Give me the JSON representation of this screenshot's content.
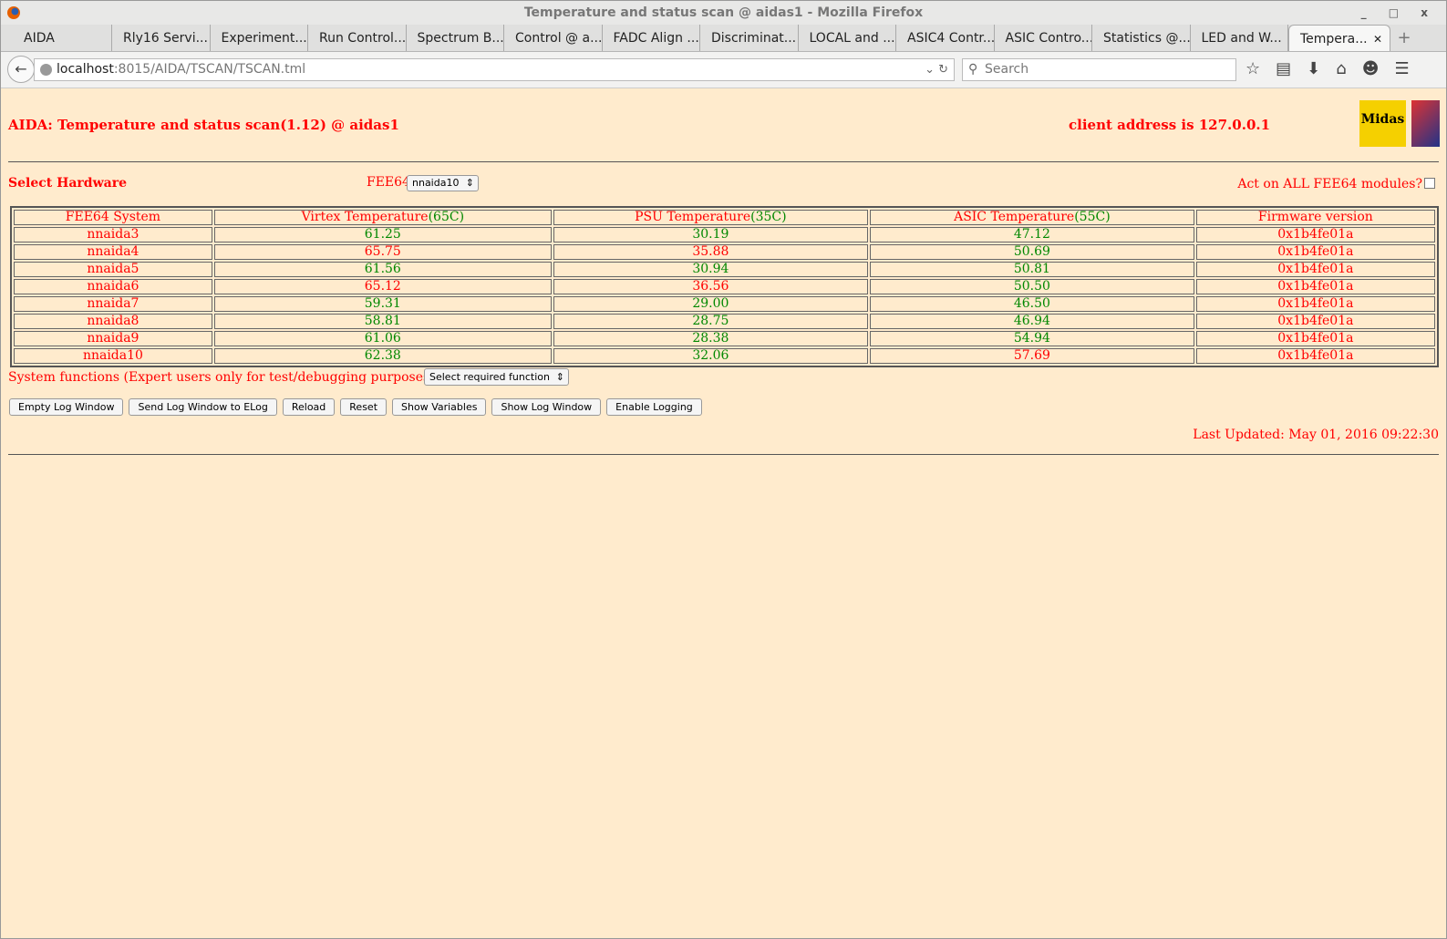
{
  "window": {
    "title": "Temperature and status scan @ aidas1 - Mozilla Firefox",
    "controls": "_ □ x"
  },
  "tabs": [
    "AIDA",
    "Rly16 Servi...",
    "Experiment...",
    "Run Control...",
    "Spectrum B...",
    "Control @ a...",
    "FADC Align ...",
    "Discriminat...",
    "LOCAL and ...",
    "ASIC4 Contr...",
    "ASIC Contro...",
    "Statistics @...",
    "LED and W...",
    "Tempera..."
  ],
  "navbar": {
    "url_host": "localhost",
    "url_rest": ":8015/AIDA/TSCAN/TSCAN.tml",
    "search_placeholder": "Search"
  },
  "page": {
    "title": "AIDA: Temperature and status scan(1.12) @ aidas1",
    "client": "client address is 127.0.0.1",
    "logo_text": "Midas",
    "select_hardware": "Select Hardware",
    "fee_label": "FEE64",
    "fee_selected": "nnaida10",
    "act_all": "Act on ALL FEE64 modules?",
    "headers": [
      {
        "t": "FEE64 System",
        "l": ""
      },
      {
        "t": "Virtex Temperature",
        "l": "(65C)"
      },
      {
        "t": "PSU Temperature",
        "l": "(35C)"
      },
      {
        "t": "ASIC Temperature",
        "l": "(55C)"
      },
      {
        "t": "Firmware version",
        "l": ""
      }
    ],
    "rows": [
      [
        "nnaida3",
        "61.25",
        "30.19",
        "47.12",
        "0x1b4fe01a"
      ],
      [
        "nnaida4",
        "65.75",
        "35.88",
        "50.69",
        "0x1b4fe01a"
      ],
      [
        "nnaida5",
        "61.56",
        "30.94",
        "50.81",
        "0x1b4fe01a"
      ],
      [
        "nnaida6",
        "65.12",
        "36.56",
        "50.50",
        "0x1b4fe01a"
      ],
      [
        "nnaida7",
        "59.31",
        "29.00",
        "46.50",
        "0x1b4fe01a"
      ],
      [
        "nnaida8",
        "58.81",
        "28.75",
        "46.94",
        "0x1b4fe01a"
      ],
      [
        "nnaida9",
        "61.06",
        "28.38",
        "54.94",
        "0x1b4fe01a"
      ],
      [
        "nnaida10",
        "62.38",
        "32.06",
        "57.69",
        "0x1b4fe01a"
      ]
    ],
    "limits": [
      65,
      35,
      55
    ],
    "system_functions": "System functions (Expert users only for test/debugging purposes!!!)",
    "function_select": "Select required function",
    "buttons": [
      "Empty Log Window",
      "Send Log Window to ELog",
      "Reload",
      "Reset",
      "Show Variables",
      "Show Log Window",
      "Enable Logging"
    ],
    "last_updated": "Last Updated: May 01, 2016 09:22:30"
  }
}
